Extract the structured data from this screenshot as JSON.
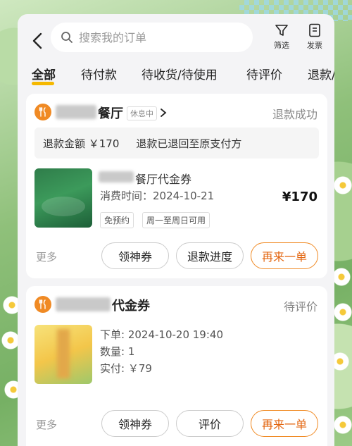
{
  "search": {
    "placeholder": "搜索我的订单"
  },
  "toolbar": {
    "filter_label": "筛选",
    "review_label": "发票"
  },
  "tabs": [
    {
      "label": "全部",
      "active": true
    },
    {
      "label": "待付款"
    },
    {
      "label": "待收货/待使用"
    },
    {
      "label": "待评价"
    },
    {
      "label": "退款/"
    }
  ],
  "orders": [
    {
      "shop_suffix": "餐厅",
      "shop_badge": "休息中",
      "status": "退款成功",
      "refund_amount": "退款金额 ￥170",
      "refund_note": "退款已退回至原支付方",
      "item_title": "餐厅代金券",
      "consume_time": "消费时间：2024-10-21",
      "price": "¥170",
      "tags": [
        "免预约",
        "周一至周日可用"
      ],
      "more": "更多",
      "buttons": [
        "领神券",
        "退款进度",
        "再来一单"
      ]
    },
    {
      "shop_suffix": "代金券",
      "status": "待评价",
      "order_time": "下单: 2024-10-20 19:40",
      "quantity": "数量: 1",
      "paid": "实付: ￥79",
      "more": "更多",
      "buttons": [
        "领神券",
        "评价",
        "再来一单"
      ]
    }
  ],
  "colors": {
    "accent": "#f08a24",
    "tab_underline": "#f5b800"
  }
}
